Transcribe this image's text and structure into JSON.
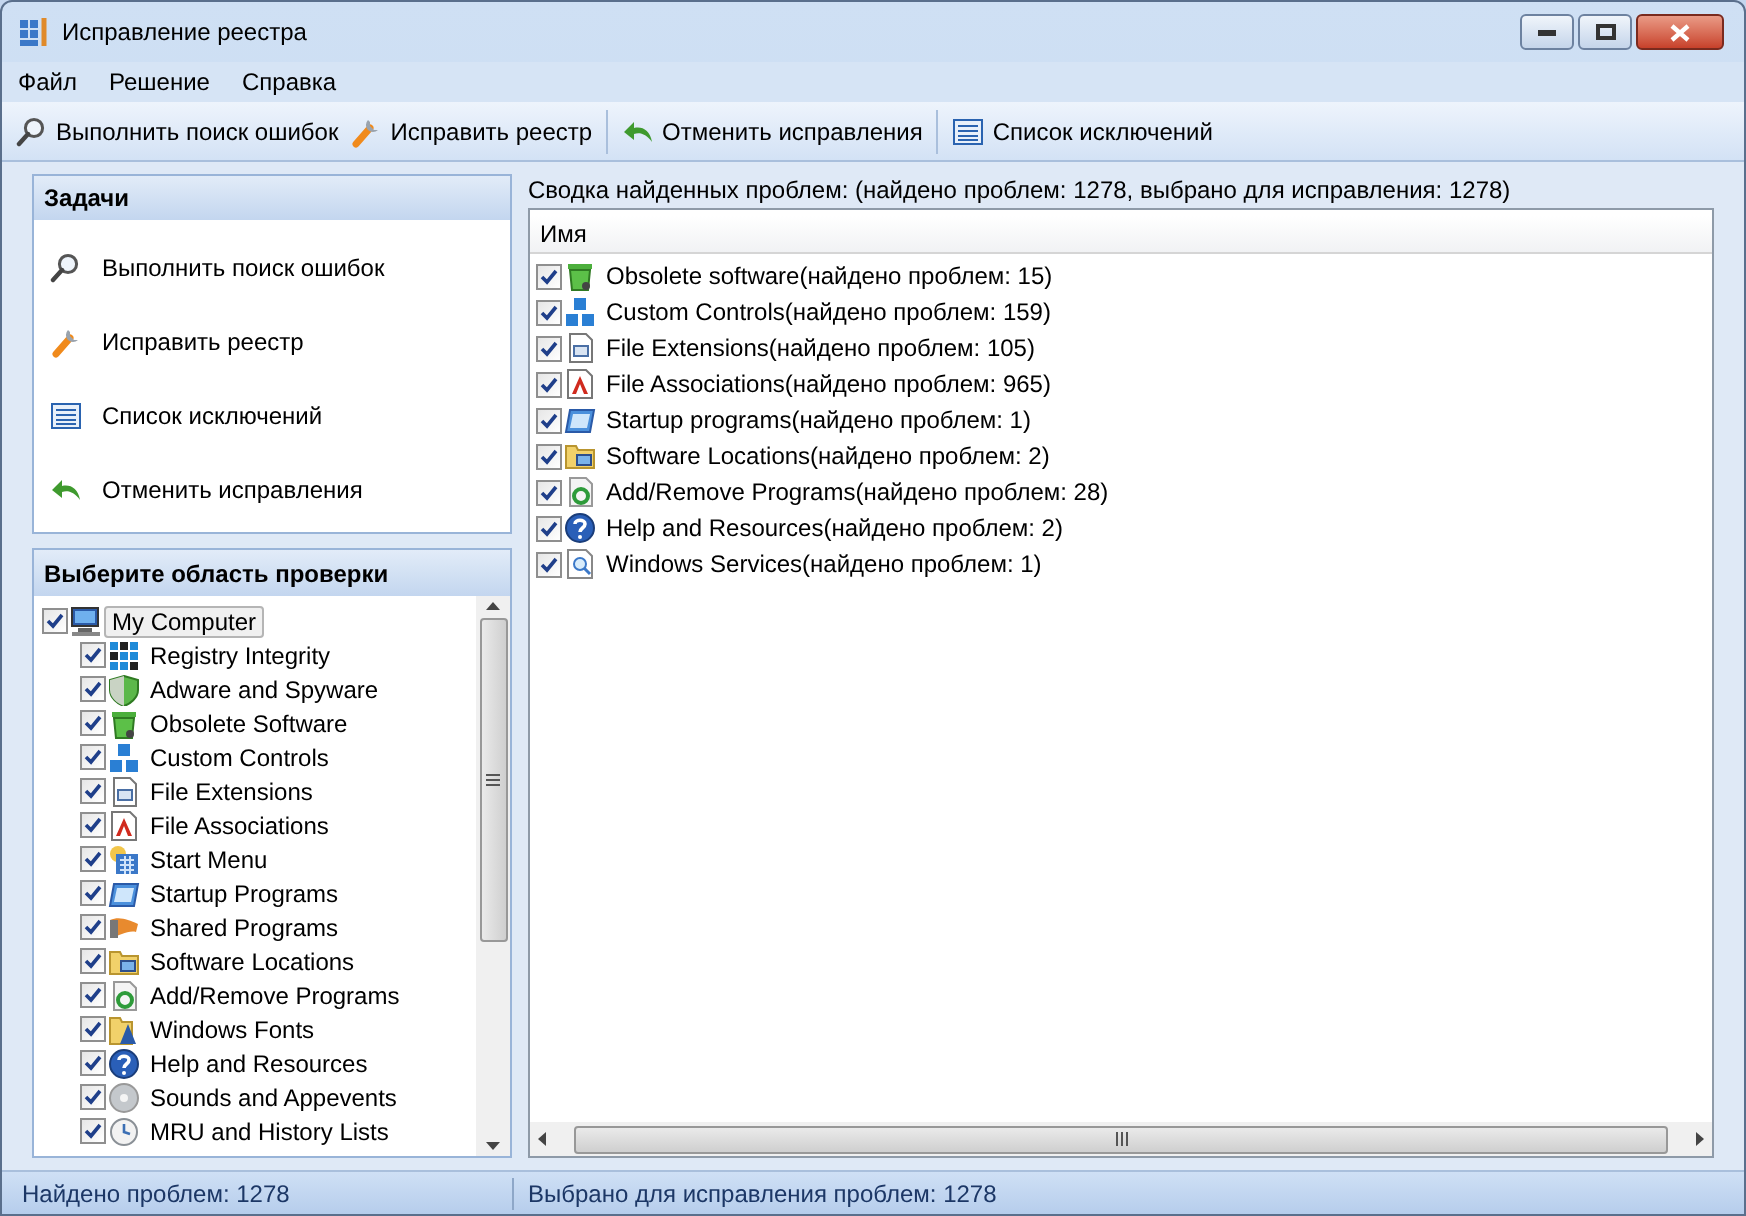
{
  "window": {
    "title": "Исправление реестра"
  },
  "menu": [
    "Файл",
    "Решение",
    "Справка"
  ],
  "toolbar": [
    "Выполнить поиск ошибок",
    "Исправить реестр",
    "Отменить исправления",
    "Список исключений"
  ],
  "tasks": {
    "title": "Задачи",
    "items": [
      "Выполнить поиск ошибок",
      "Исправить реестр",
      "Список исключений",
      "Отменить исправления"
    ]
  },
  "scope": {
    "title": "Выберите область проверки",
    "tree": [
      {
        "label": "My Computer",
        "checked": true,
        "selected": true,
        "children": [
          {
            "label": "Registry Integrity",
            "checked": true,
            "selected": false
          },
          {
            "label": "Adware and Spyware",
            "checked": true,
            "selected": false
          },
          {
            "label": "Obsolete Software",
            "checked": true,
            "selected": false
          },
          {
            "label": "Custom Controls",
            "checked": true,
            "selected": false
          },
          {
            "label": "File Extensions",
            "checked": true,
            "selected": false
          },
          {
            "label": "File Associations",
            "checked": true,
            "selected": false
          },
          {
            "label": "Start Menu",
            "checked": true,
            "selected": false
          },
          {
            "label": "Startup Programs",
            "checked": true,
            "selected": false
          },
          {
            "label": "Shared Programs",
            "checked": true,
            "selected": false
          },
          {
            "label": "Software Locations",
            "checked": true,
            "selected": false
          },
          {
            "label": "Add/Remove Programs",
            "checked": true,
            "selected": false
          },
          {
            "label": "Windows Fonts",
            "checked": true,
            "selected": false
          },
          {
            "label": "Help and Resources",
            "checked": true,
            "selected": false
          },
          {
            "label": "Sounds and Appevents",
            "checked": true,
            "selected": false
          },
          {
            "label": "MRU and History Lists",
            "checked": true,
            "selected": false
          }
        ]
      }
    ]
  },
  "summary": "Сводка найденных проблем: (найдено проблем: 1278, выбрано для исправления: 1278)",
  "results": {
    "columns": [
      "Имя"
    ],
    "rows": [
      {
        "label": "Obsolete software(найдено проблем: 15)",
        "checked": true
      },
      {
        "label": "Custom Controls(найдено проблем: 159)",
        "checked": true
      },
      {
        "label": "File Extensions(найдено проблем: 105)",
        "checked": true
      },
      {
        "label": "File Associations(найдено проблем: 965)",
        "checked": true
      },
      {
        "label": "Startup programs(найдено проблем: 1)",
        "checked": true
      },
      {
        "label": "Software Locations(найдено проблем: 2)",
        "checked": true
      },
      {
        "label": "Add/Remove Programs(найдено проблем: 28)",
        "checked": true
      },
      {
        "label": "Help and Resources(найдено проблем: 2)",
        "checked": true
      },
      {
        "label": "Windows Services(найдено проблем: 1)",
        "checked": true
      }
    ]
  },
  "status_bar": [
    "Найдено проблем: 1278",
    "Выбрано для исправления проблем: 1278"
  ]
}
